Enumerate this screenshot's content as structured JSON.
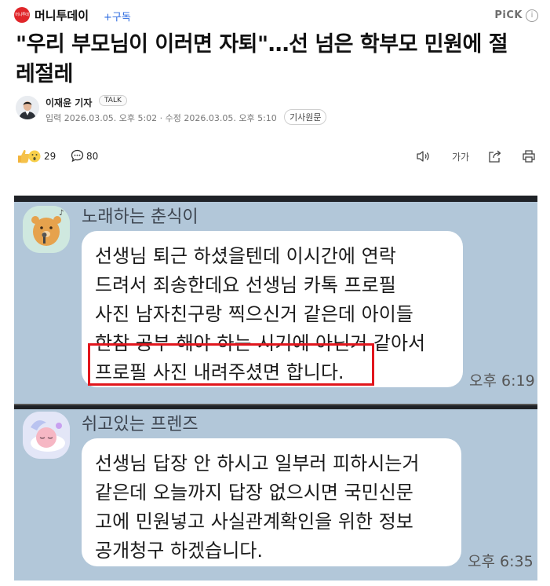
{
  "press": {
    "logo_text": "머니투데이",
    "name": "머니투데이",
    "subscribe_label": "+구독",
    "pick_label": "PiCK",
    "info_icon": "info-icon",
    "brand_color": "#e0262a"
  },
  "article": {
    "headline_line1": "\"우리 부모님이 이러면 자퇴\"…선 넘은 학부모 민원에 절",
    "headline_line2": "레절레",
    "author": "이재윤 기자",
    "talk_label": "TALK",
    "dates": "입력 2026.03.05. 오후 5:02 · 수정 2026.03.05. 오후 5:10",
    "original_label": "기사원문"
  },
  "actions": {
    "reaction_icons": [
      "like-hand-icon",
      "surprise-icon"
    ],
    "reaction_count": "29",
    "comment_icon": "comment-bubble-icon",
    "comment_count": "80",
    "tools": [
      {
        "name": "listen-icon"
      },
      {
        "name": "font-size-button",
        "label": "가가"
      },
      {
        "name": "share-icon"
      },
      {
        "name": "print-icon"
      }
    ]
  },
  "chat": {
    "background_color": "#b2c7d9",
    "highlight_color": "#e1161d",
    "messages": [
      {
        "sender": "노래하는 춘식이",
        "lines": [
          "선생님 퇴근 하셨을텐데 이시간에 연락",
          "드려서 죄송한데요 선생님 카톡 프로필",
          "사진 남자친구랑 찍으신거 같은데 아이들",
          "한참 공부 해야 하는 시기에 아닌거 같아서",
          "프로필 사진 내려주셨면 합니다."
        ],
        "time": "오후 6:19"
      },
      {
        "sender": "쉬고있는 프렌즈",
        "lines": [
          "선생님 답장 안 하시고 일부러 피하시는거",
          "같은데 오늘까지 답장 없으시면 국민신문",
          "고에 민원넣고 사실관계확인을 위한 정보",
          "공개청구 하겠습니다."
        ],
        "time": "오후 6:35"
      }
    ]
  }
}
